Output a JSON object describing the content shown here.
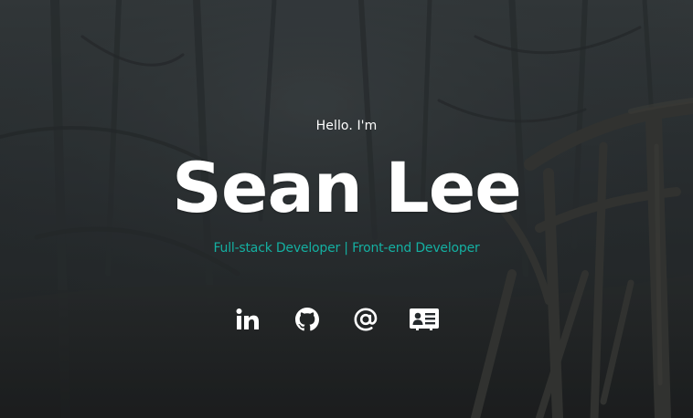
{
  "hero": {
    "greeting": "Hello. I'm",
    "name": "Sean Lee",
    "subtitle": "Full-stack Developer | Front-end Developer"
  },
  "social_links": [
    {
      "icon": "linkedin-icon",
      "label": "in"
    },
    {
      "icon": "github-icon"
    },
    {
      "icon": "email-icon",
      "label": "@"
    },
    {
      "icon": "resume-card-icon"
    }
  ],
  "colors": {
    "accent": "#14b0a2",
    "text": "#ffffff",
    "background": "#252a2d"
  }
}
